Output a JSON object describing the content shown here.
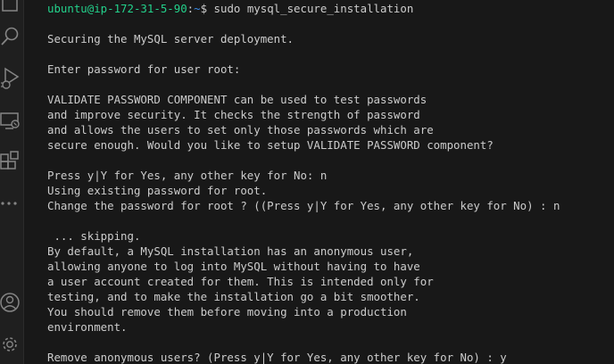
{
  "activity_bar": {
    "icons": [
      {
        "name": "files-icon"
      },
      {
        "name": "search-icon"
      },
      {
        "name": "run-debug-icon"
      },
      {
        "name": "remote-explorer-icon"
      },
      {
        "name": "extensions-icon"
      },
      {
        "name": "more-icon"
      },
      {
        "name": "accounts-icon"
      },
      {
        "name": "settings-gear-icon"
      }
    ],
    "color": "#858585"
  },
  "terminal": {
    "prompt": {
      "user_host": "ubuntu@ip-172-31-5-90",
      "colon": ":",
      "path": "~",
      "symbol": "$",
      "command": " sudo mysql_secure_installation"
    },
    "lines": [
      "",
      "Securing the MySQL server deployment.",
      "",
      "Enter password for user root:",
      "",
      "VALIDATE PASSWORD COMPONENT can be used to test passwords",
      "and improve security. It checks the strength of password",
      "and allows the users to set only those passwords which are",
      "secure enough. Would you like to setup VALIDATE PASSWORD component?",
      "",
      "Press y|Y for Yes, any other key for No: n",
      "Using existing password for root.",
      "Change the password for root ? ((Press y|Y for Yes, any other key for No) : n",
      "",
      " ... skipping.",
      "By default, a MySQL installation has an anonymous user,",
      "allowing anyone to log into MySQL without having to have",
      "a user account created for them. This is intended only for",
      "testing, and to make the installation go a bit smoother.",
      "You should remove them before moving into a production",
      "environment.",
      "",
      "Remove anonymous users? (Press y|Y for Yes, any other key for No) : y"
    ],
    "colors": {
      "background": "#181818",
      "text": "#cccccc",
      "user_host": "#23d18b",
      "path": "#3b8eea"
    }
  }
}
